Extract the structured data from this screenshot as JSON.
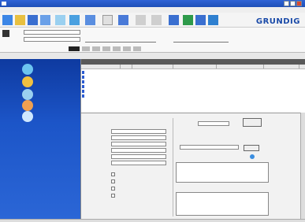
{
  "app": {
    "title": "",
    "logo": "GRUNDIG"
  },
  "menu": {
    "items": [
      "",
      "",
      "",
      "",
      ""
    ]
  },
  "window": {
    "controls": [
      "minimize",
      "maximize",
      "close"
    ]
  },
  "colors": {
    "titlebar": "#2f63d6",
    "sidebar": "#1c55c8",
    "logo": "#1a4aa8"
  },
  "toolbar": {
    "icons": [
      "new",
      "open",
      "save",
      "print",
      "copy",
      "paste",
      "delete",
      "props",
      "find",
      "back",
      "forward",
      "home",
      "help",
      "globe",
      "flag"
    ]
  },
  "sidebar": {
    "items": [
      {
        "label": ""
      },
      {
        "label": ""
      },
      {
        "label": ""
      },
      {
        "label": ""
      },
      {
        "label": ""
      }
    ]
  },
  "list": {
    "header": "",
    "columns": [
      "",
      "",
      "",
      "",
      "",
      ""
    ],
    "rows": [
      [
        "",
        "",
        "",
        "",
        "",
        ""
      ],
      [
        "",
        "",
        "",
        "",
        "",
        ""
      ],
      [
        "",
        "",
        "",
        "",
        "",
        ""
      ],
      [
        "",
        "",
        "",
        "",
        "",
        ""
      ],
      [
        "",
        "",
        "",
        "",
        "",
        ""
      ],
      [
        "",
        "",
        "",
        "",
        "",
        ""
      ]
    ]
  },
  "detail": {
    "button_label": "",
    "button2_label": ""
  }
}
